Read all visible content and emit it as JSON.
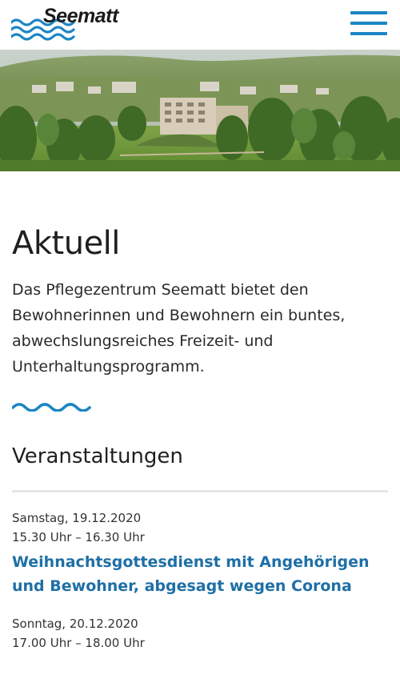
{
  "header": {
    "logo_text": "Seematt",
    "menu_icon": "hamburger-menu-icon"
  },
  "hero": {
    "image": "building-landscape-photo"
  },
  "main": {
    "title": "Aktuell",
    "intro": "Das Pflegezentrum Seematt bietet den Bewohnerinnen und Bewohnern ein buntes, abwechslungsreiches Freizeit- und Unterhaltungsprogramm.",
    "divider_icon": "wave-divider-icon"
  },
  "events_section": {
    "title": "Veranstaltungen",
    "events": [
      {
        "date": "Samstag, 19.12.2020",
        "time": "15.30 Uhr – 16.30 Uhr",
        "title": "Weihnachtsgottesdienst mit Angehörigen und Bewohner, abgesagt wegen Corona"
      },
      {
        "date": "Sonntag, 20.12.2020",
        "time": "17.00 Uhr – 18.00 Uhr",
        "title": ""
      }
    ]
  },
  "colors": {
    "brand_blue": "#1b85c4",
    "link_blue": "#1e6fa6",
    "text": "#1f1f1f",
    "rule": "#e6e6e6"
  }
}
